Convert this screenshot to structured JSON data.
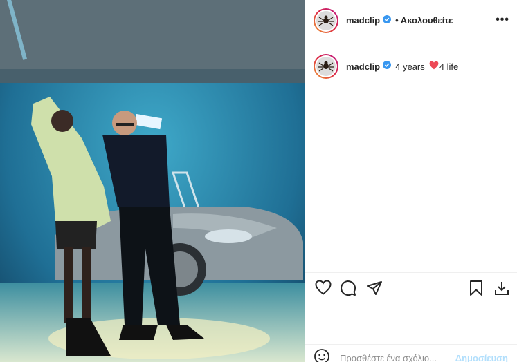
{
  "post": {
    "username": "madclip",
    "follow_label": "• Ακολουθείτε",
    "more_label": "•••",
    "caption": {
      "username": "madclip",
      "text_before": "4 years",
      "text_after": "4 life"
    }
  },
  "comment": {
    "placeholder": "Προσθέστε ένα σχόλιο...",
    "post_label": "Δημοσίευση"
  },
  "icons": {
    "verified": "verified-badge-icon",
    "heart": "heart-icon",
    "comment": "comment-icon",
    "share": "share-icon",
    "bookmark": "bookmark-icon",
    "download": "download-icon",
    "emoji": "emoji-icon"
  },
  "colors": {
    "verified": "#3897f0",
    "heart_red": "#ed4956",
    "post_button": "#b2dffc"
  }
}
